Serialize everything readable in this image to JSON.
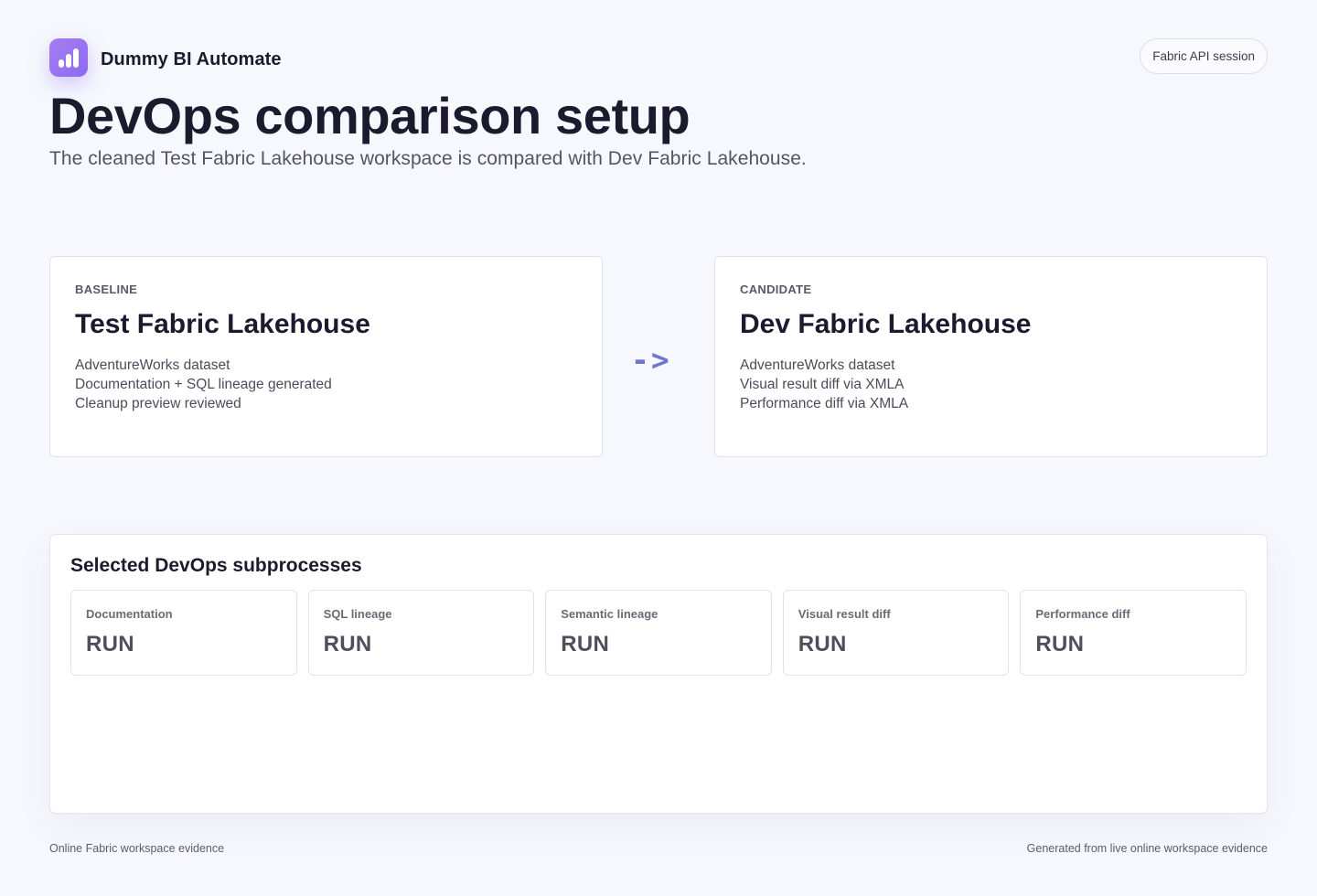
{
  "brand": {
    "name": "Dummy BI Automate",
    "logo_icon": "bar-chart-icon"
  },
  "header": {
    "session_badge": "Fabric API session",
    "title": "DevOps comparison setup",
    "subtitle": "The cleaned Test Fabric Lakehouse workspace is compared with Dev Fabric Lakehouse."
  },
  "comparison": {
    "baseline": {
      "kicker": "BASELINE",
      "name": "Test Fabric Lakehouse",
      "lines": [
        "AdventureWorks dataset",
        "Documentation + SQL lineage generated",
        "Cleanup preview reviewed"
      ]
    },
    "arrow": "->",
    "candidate": {
      "kicker": "CANDIDATE",
      "name": "Dev Fabric Lakehouse",
      "lines": [
        "AdventureWorks dataset",
        "Visual result diff via XMLA",
        "Performance diff via XMLA"
      ]
    }
  },
  "subprocesses": {
    "title": "Selected DevOps subprocesses",
    "items": [
      {
        "label": "Documentation",
        "status": "RUN"
      },
      {
        "label": "SQL lineage",
        "status": "RUN"
      },
      {
        "label": "Semantic lineage",
        "status": "RUN"
      },
      {
        "label": "Visual result diff",
        "status": "RUN"
      },
      {
        "label": "Performance diff",
        "status": "RUN"
      }
    ]
  },
  "footer": {
    "left": "Online Fabric workspace evidence",
    "right": "Generated from live online workspace evidence"
  },
  "colors": {
    "accent": "#8b6cf0",
    "arrow": "#7176c9",
    "background": "#f7f8fd"
  }
}
